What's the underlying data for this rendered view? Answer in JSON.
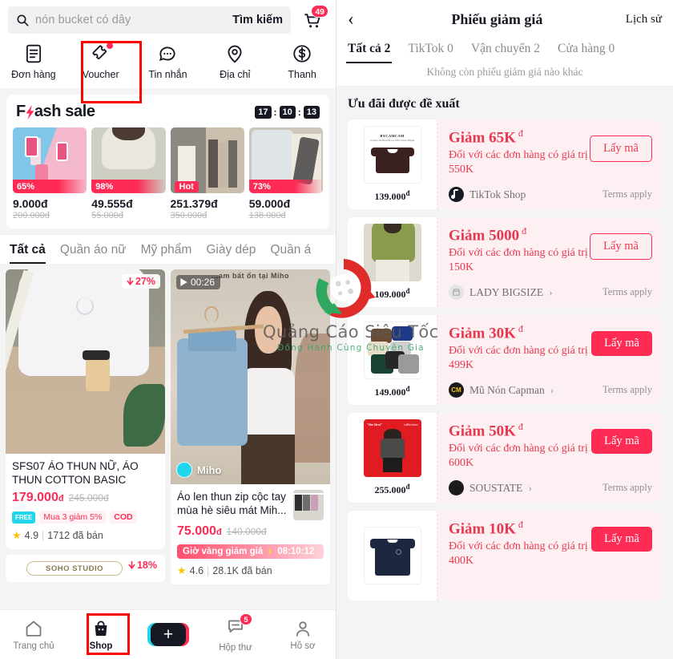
{
  "colors": {
    "brand_red": "#fe2c55",
    "brand_cyan": "#20d5ec",
    "ink": "#161823",
    "voucher_red": "#e8384f",
    "voucher_bg": "#fdf0f2",
    "highlight_box": "#ff0000"
  },
  "left": {
    "search": {
      "placeholder": "nón bucket có dây",
      "button_label": "Tìm kiếm",
      "icon": "search-icon",
      "cart_icon": "cart-icon",
      "cart_badge": "49"
    },
    "quick_actions": [
      {
        "label": "Đơn hàng",
        "icon": "order-list-icon",
        "dot": false
      },
      {
        "label": "Voucher",
        "icon": "voucher-ticket-icon",
        "dot": true
      },
      {
        "label": "Tin nhắn",
        "icon": "chat-bubble-icon",
        "dot": false
      },
      {
        "label": "Địa chỉ",
        "icon": "location-pin-icon",
        "dot": false
      },
      {
        "label": "Thanh",
        "icon": "payment-coin-icon",
        "dot": false
      }
    ],
    "flash_sale": {
      "title_pre": "F",
      "title_post": "ash sale",
      "bolt_icon": "lightning-bolt-icon",
      "timer": {
        "hours": "17",
        "minutes": "10",
        "seconds": "13",
        "sep": ":"
      },
      "items": [
        {
          "tag": "65%",
          "price": "9.000đ",
          "old_price": "200.000đ",
          "hot": false
        },
        {
          "tag": "98%",
          "price": "49.555đ",
          "old_price": "55.000đ",
          "hot": false
        },
        {
          "tag": "Hot",
          "price": "251.379đ",
          "old_price": "350.000đ",
          "hot": true
        },
        {
          "tag": "73%",
          "price": "59.000đ",
          "old_price": "138.000đ",
          "hot": false
        }
      ]
    },
    "categories": [
      {
        "label": "Tất cả",
        "active": true
      },
      {
        "label": "Quần áo nữ",
        "active": false
      },
      {
        "label": "Mỹ phẩm",
        "active": false
      },
      {
        "label": "Giày dép",
        "active": false
      },
      {
        "label": "Quần á",
        "active": false
      }
    ],
    "products": [
      {
        "discount": "27%",
        "discount_icon": "arrow-down-icon",
        "title": "SFS07 ÁO THUN NỮ, ÁO THUN COTTON BASIC",
        "price": "179.000",
        "currency": "đ",
        "old_price": "245.000đ",
        "badges": [
          {
            "type": "free-ship",
            "label": "FREE"
          },
          {
            "type": "promo",
            "label": "Mua 3 giảm 5%"
          },
          {
            "type": "cod",
            "label": "COD"
          }
        ],
        "rating": "4.9",
        "sold": "1712 đã bán",
        "star_icon": "star-icon"
      },
      {
        "video_duration": "00:26",
        "play_icon": "play-icon",
        "seller_overlay": "Miho",
        "video_caption": "...am bất ổn tại Miho",
        "title": "Áo len thun zip cộc tay mùa hè siêu mát Mih...",
        "price": "75.000",
        "currency": "đ",
        "old_price": "140.000đ",
        "gold_hour": {
          "label": "Giờ vàng giảm giá",
          "icon": "lightning-bolt-icon",
          "time": "08:10:12"
        },
        "rating": "4.6",
        "sold": "28.1K đã bán",
        "star_icon": "star-icon"
      }
    ],
    "studio_strip": {
      "label": "SOHO STUDIO",
      "discount": "18%",
      "discount_icon": "arrow-down-icon"
    },
    "bottom_nav": [
      {
        "label": "Trang chủ",
        "icon": "home-icon",
        "active": false,
        "badge": ""
      },
      {
        "label": "Shop",
        "icon": "shop-bag-icon",
        "active": true,
        "badge": ""
      },
      {
        "label": "",
        "icon": "plus-create-icon",
        "active": false,
        "badge": ""
      },
      {
        "label": "Hộp thư",
        "icon": "inbox-icon",
        "active": false,
        "badge": "5"
      },
      {
        "label": "Hồ sơ",
        "icon": "profile-person-icon",
        "active": false,
        "badge": ""
      }
    ]
  },
  "right": {
    "header": {
      "back_icon": "chevron-left-icon",
      "title": "Phiếu giảm giá",
      "history_label": "Lịch sử"
    },
    "tabs": [
      {
        "label": "Tất cả 2",
        "active": true
      },
      {
        "label": "TikTok 0",
        "active": false
      },
      {
        "label": "Vận chuyển 2",
        "active": false
      },
      {
        "label": "Cửa hàng 0",
        "active": false
      }
    ],
    "empty_note": "Không còn phiếu giảm giá nào khác",
    "section_title": "Ưu đãi được đề xuất",
    "vouchers": [
      {
        "thumb_price": "139.000",
        "thumb_currency": "đ",
        "amount": "Giảm 65K",
        "amount_currency": "đ",
        "desc": "Đối với các đơn hàng có giá trị trên 550K",
        "shop": "TikTok Shop",
        "shop_icon": "tiktok-note-icon",
        "has_chevron": false,
        "terms": "Terms apply",
        "button_label": "Lấy mã",
        "button_style": "outline",
        "highlighted": true
      },
      {
        "thumb_price": "109.000",
        "thumb_currency": "đ",
        "amount": "Giảm 5000",
        "amount_currency": "đ",
        "desc": "Đối với các đơn hàng có giá trị trên 150K",
        "shop": "LADY BIGSIZE",
        "shop_icon": "store-icon",
        "has_chevron": true,
        "terms": "Terms apply",
        "button_label": "Lấy mã",
        "button_style": "outline",
        "highlighted": true
      },
      {
        "thumb_price": "149.000",
        "thumb_currency": "đ",
        "amount": "Giảm 30K",
        "amount_currency": "đ",
        "desc": "Đối với các đơn hàng có giá trị trên 499K",
        "shop": "Mũ Nón Capman",
        "shop_icon": "capman-logo-icon",
        "has_chevron": true,
        "terms": "Terms apply",
        "button_label": "Lấy mã",
        "button_style": "solid",
        "highlighted": false
      },
      {
        "thumb_price": "255.000",
        "thumb_currency": "đ",
        "amount": "Giảm 50K",
        "amount_currency": "đ",
        "desc": "Đối với các đơn hàng có giá trị trên 600K",
        "shop": "SOUSTATE",
        "shop_icon": "soustate-logo-icon",
        "has_chevron": true,
        "terms": "Terms apply",
        "button_label": "Lấy mã",
        "button_style": "solid",
        "highlighted": false
      },
      {
        "thumb_price": "",
        "thumb_currency": "",
        "amount": "Giảm 10K",
        "amount_currency": "đ",
        "desc": "Đối với các đơn hàng có giá trị trên 400K",
        "shop": "",
        "shop_icon": "",
        "has_chevron": false,
        "terms": "",
        "button_label": "Lấy mã",
        "button_style": "solid",
        "highlighted": false
      }
    ]
  },
  "watermark": {
    "text": "Quảng Cáo Siêu Tốc",
    "subtitle": "Đồng Hành Cùng Chuyên Gia",
    "icon": "swirl-logo-icon"
  }
}
